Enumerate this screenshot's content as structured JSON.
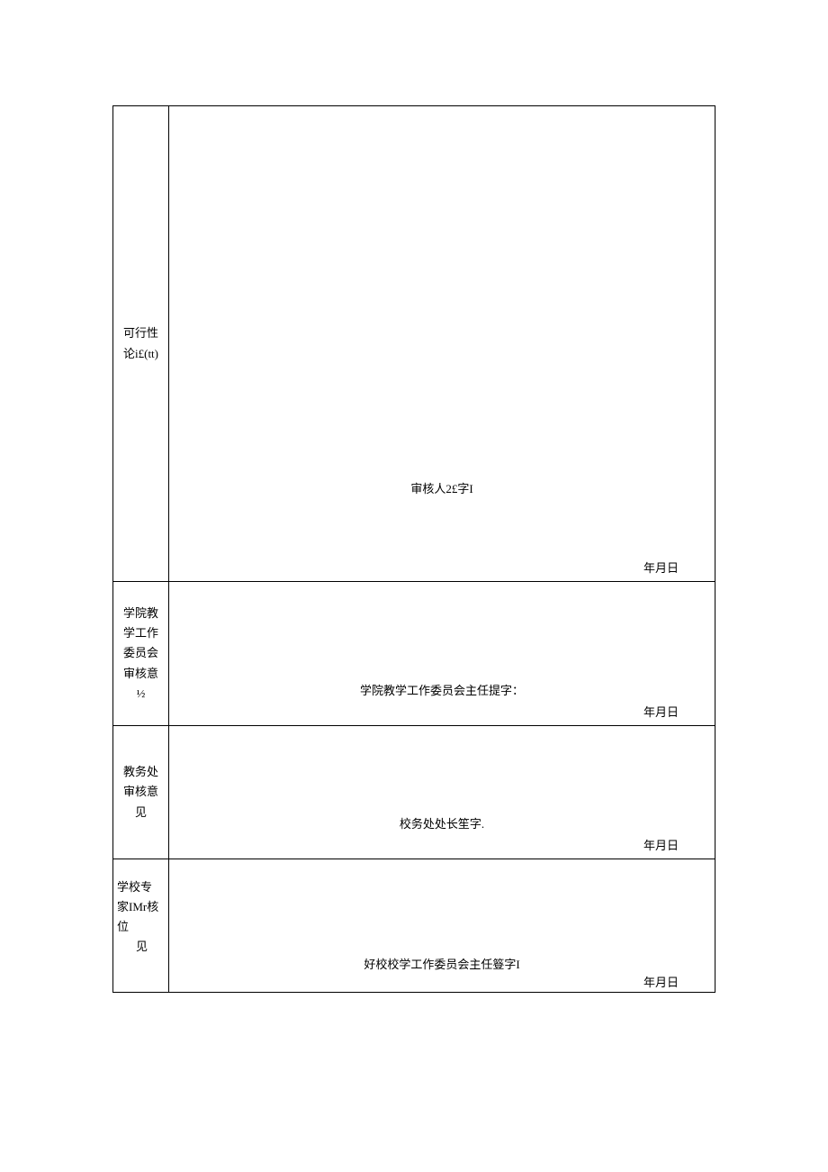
{
  "rows": [
    {
      "label_lines": [
        "可行性",
        "论i£(tt)"
      ],
      "signer": "审核人2£字I",
      "date": "年月日"
    },
    {
      "label_lines": [
        "学院教",
        "学工作",
        "委员会",
        "审核意",
        "½"
      ],
      "signer": "学院教学工作委员会主任提字：",
      "date": "年月日"
    },
    {
      "label_lines": [
        "教务处",
        "审核意",
        "见"
      ],
      "signer": "校务处处长笙字.",
      "date": "年月日"
    },
    {
      "label_lines": [
        "学校专",
        "家IMr核",
        "位",
        "见"
      ],
      "signer": "好校校学工作委员会主任簦字I",
      "date": "年月日"
    }
  ]
}
